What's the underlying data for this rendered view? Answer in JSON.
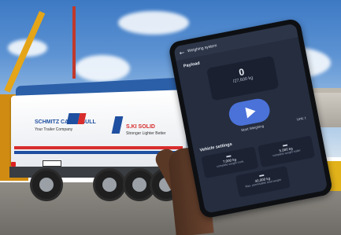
{
  "scene": {
    "trailer_brand": "SCHMITZ CARGOBULL",
    "trailer_tagline": "Your Trailer Company",
    "trailer_model": "S.KI SOLID",
    "trailer_model_sub": "Stronger Lighter Better"
  },
  "tablet": {
    "app_title": "Weighing system",
    "back_icon": "back-arrow-icon",
    "payload": {
      "label": "Payload",
      "current": "0",
      "max": "/27,600 kg"
    },
    "start_label": "Start Weighing",
    "unit_label": "Unit: t",
    "vehicle_settings": {
      "label": "Vehicle settings",
      "cards": [
        {
          "value": "7,000 kg",
          "label": "complete weight truck"
        },
        {
          "value": "5,000 kg",
          "label": "complete weight trailer"
        },
        {
          "value": "40,000 kg",
          "label": "Max. permissible total weight"
        }
      ]
    }
  }
}
